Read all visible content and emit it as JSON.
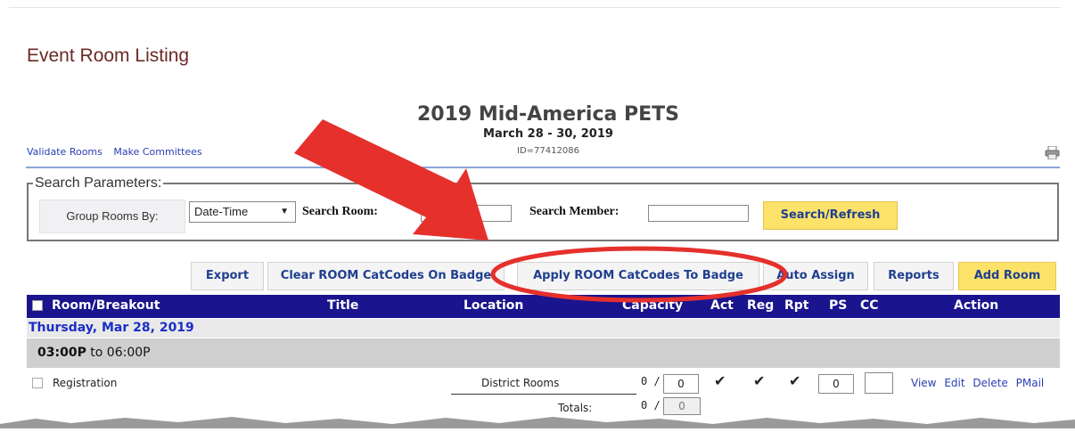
{
  "page": {
    "title": "Event Room Listing"
  },
  "event": {
    "title": "2019 Mid-America PETS",
    "dates": "March 28 - 30, 2019",
    "id": "ID=77412086"
  },
  "links": {
    "validate": "Validate Rooms",
    "committees": "Make Committees"
  },
  "search": {
    "legend": "Search Parameters:",
    "group_label": "Group Rooms By:",
    "group_value": "Date-Time",
    "room_label": "Search Room:",
    "member_label": "Search Member:",
    "button": "Search/Refresh"
  },
  "toolbar": {
    "export": "Export",
    "clear": "Clear ROOM CatCodes On Badge",
    "apply": "Apply ROOM CatCodes To Badge",
    "auto": "Auto Assign",
    "reports": "Reports",
    "add": "Add Room"
  },
  "columns": {
    "room": "Room/Breakout",
    "title": "Title",
    "location": "Location",
    "capacity": "Capacity",
    "act": "Act",
    "reg": "Reg",
    "rpt": "Rpt",
    "ps": "PS",
    "cc": "CC",
    "action": "Action"
  },
  "group": {
    "day": "Thursday, Mar 28, 2019",
    "time_start": "03:00P",
    "time_to": "to",
    "time_end": "06:00P"
  },
  "rows": [
    {
      "name": "Registration",
      "location": "District Rooms",
      "cap_used": "0 /",
      "cap_value": "0",
      "act": "✔",
      "reg": "✔",
      "rpt": "✔",
      "ps": "0",
      "cc": "",
      "actions": {
        "view": "View",
        "edit": "Edit",
        "delete": "Delete",
        "pmail": "PMail"
      }
    }
  ],
  "totals": {
    "label": "Totals:",
    "used": "0 /",
    "value": "0"
  },
  "colors": {
    "header_bg": "#1a148e",
    "accent_yellow": "#fde26a",
    "title_brown": "#6b2a26",
    "annotation_red": "#e5302c"
  },
  "icons": {
    "printer": "printer-icon",
    "dropdown": "dropdown-arrow-icon"
  }
}
